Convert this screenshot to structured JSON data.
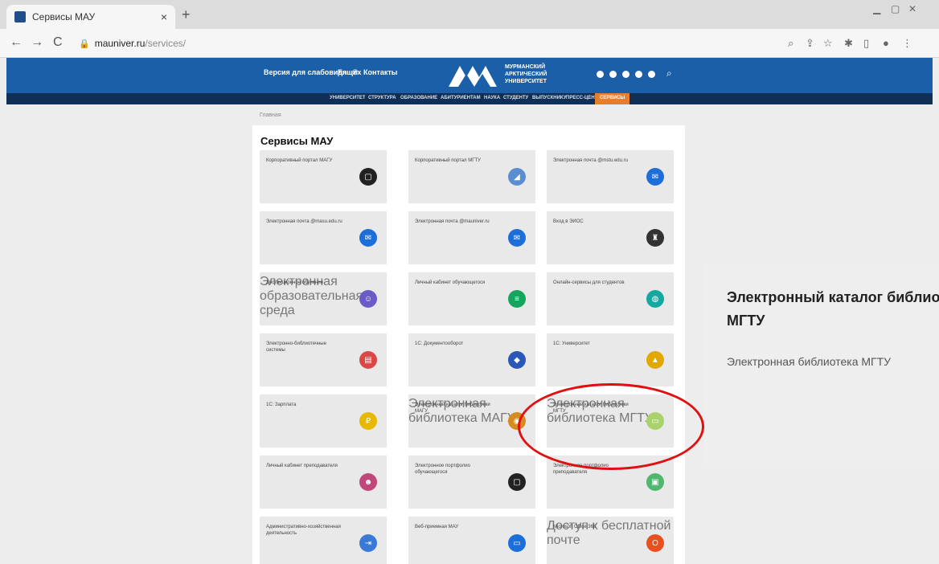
{
  "browser": {
    "tab_title": "Сервисы МАУ",
    "tab_close": "×",
    "new_tab": "+",
    "back": "←",
    "forward": "→",
    "reload": "C",
    "url_host": "mauniver.ru",
    "url_path": "/services/"
  },
  "header": {
    "accessibility_label": "Версия для слабовидящих",
    "lang_label": "En",
    "contacts_label": "Контакты",
    "logo_text": "МУРМАНСКИЙ АРКТИЧЕСКИЙ УНИВЕРСИТЕТ",
    "brand_color": "#1b5fa8",
    "menu": [
      "УНИВЕРСИТЕТ",
      "СТРУКТУРА",
      "ОБРАЗОВАНИЕ",
      "АБИТУРИЕНТАМ",
      "НАУКА",
      "СТУДЕНТУ",
      "ВЫПУСКНИКУ",
      "ПРЕСС-ЦЕНТР",
      "СЕРВИСЫ"
    ]
  },
  "breadcrumb": "Главная",
  "page": {
    "title": "Сервисы МАУ",
    "cards": [
      {
        "title": "Корпоративный портал МАГУ",
        "desc": "",
        "icon": "calendar-icon",
        "color": "#222222",
        "glyph": "▢"
      },
      {
        "title": "Корпоративный портал МГТУ",
        "desc": "",
        "icon": "portal-icon",
        "color": "#5b8ed1",
        "glyph": "◢"
      },
      {
        "title": "Электронная почта @mstu.edu.ru",
        "desc": "",
        "icon": "mail-icon",
        "color": "#1c6ed8",
        "glyph": "✉"
      },
      {
        "title": "Электронная почта @masu.edu.ru",
        "desc": "",
        "icon": "mail-icon",
        "color": "#1c6ed8",
        "glyph": "✉"
      },
      {
        "title": "Электронная почта @mauniver.ru",
        "desc": "",
        "icon": "mail-icon",
        "color": "#1c6ed8",
        "glyph": "✉"
      },
      {
        "title": "Вход в ЭИОС",
        "desc": "",
        "icon": "login-icon",
        "color": "#333333",
        "glyph": "♜"
      },
      {
        "title": "Дистанционное обучение",
        "desc": "Электронная образовательная среда",
        "icon": "student-icon",
        "color": "#6a5bc8",
        "glyph": "☺"
      },
      {
        "title": "Личный кабинет обучающегося",
        "desc": "",
        "icon": "list-icon",
        "color": "#17a55d",
        "glyph": "≡"
      },
      {
        "title": "Онлайн-сервисы для студентов",
        "desc": "",
        "icon": "globe-icon",
        "color": "#14a9a0",
        "glyph": "◍"
      },
      {
        "title": "Электронно-библиотечные системы",
        "desc": "",
        "icon": "library-icon",
        "color": "#d94747",
        "glyph": "▤"
      },
      {
        "title": "1С: Документооборот",
        "desc": "",
        "icon": "shield-icon",
        "color": "#2b57b6",
        "glyph": "◆"
      },
      {
        "title": "1С: Университет",
        "desc": "",
        "icon": "university-icon",
        "color": "#e0a800",
        "glyph": "▲"
      },
      {
        "title": "1С: Зарплата",
        "desc": "",
        "icon": "salary-icon",
        "color": "#e8b800",
        "glyph": "₽"
      },
      {
        "title": "Электронный каталог библиотеки МАГУ",
        "desc": "Электронная библиотека МАГУ",
        "icon": "catalog-icon",
        "color": "#d48b1f",
        "glyph": "◉"
      },
      {
        "title": "Электронный каталог библиотеки МГТУ",
        "desc": "Электронная библиотека МГТУ",
        "icon": "catalog-book-icon",
        "color": "#a8d36a",
        "glyph": "▭"
      },
      {
        "title": "Личный кабинет преподавателя",
        "desc": "",
        "icon": "teacher-icon",
        "color": "#c0467c",
        "glyph": "☻"
      },
      {
        "title": "Электронное портфолио обучающегося",
        "desc": "",
        "icon": "portfolio-icon",
        "color": "#222222",
        "glyph": "▢"
      },
      {
        "title": "Электронное портфолио преподавателя",
        "desc": "",
        "icon": "portfolio-teacher-icon",
        "color": "#4fb86f",
        "glyph": "▣"
      },
      {
        "title": "Административно-хозяйственная деятельность",
        "desc": "",
        "icon": "admin-icon",
        "color": "#3a7ad6",
        "glyph": "⇥"
      },
      {
        "title": "Веб-приемная МАУ",
        "desc": "",
        "icon": "monitor-icon",
        "color": "#1c6ed8",
        "glyph": "▭"
      },
      {
        "title": "Microsoft Office 365",
        "desc": "Доступ к бесплатной почте",
        "icon": "office-icon",
        "color": "#e8501f",
        "glyph": "O"
      }
    ]
  },
  "popout": {
    "title": "Электронный каталог библиотеки МГТУ",
    "desc": "Электронная библиотека МГТУ"
  }
}
